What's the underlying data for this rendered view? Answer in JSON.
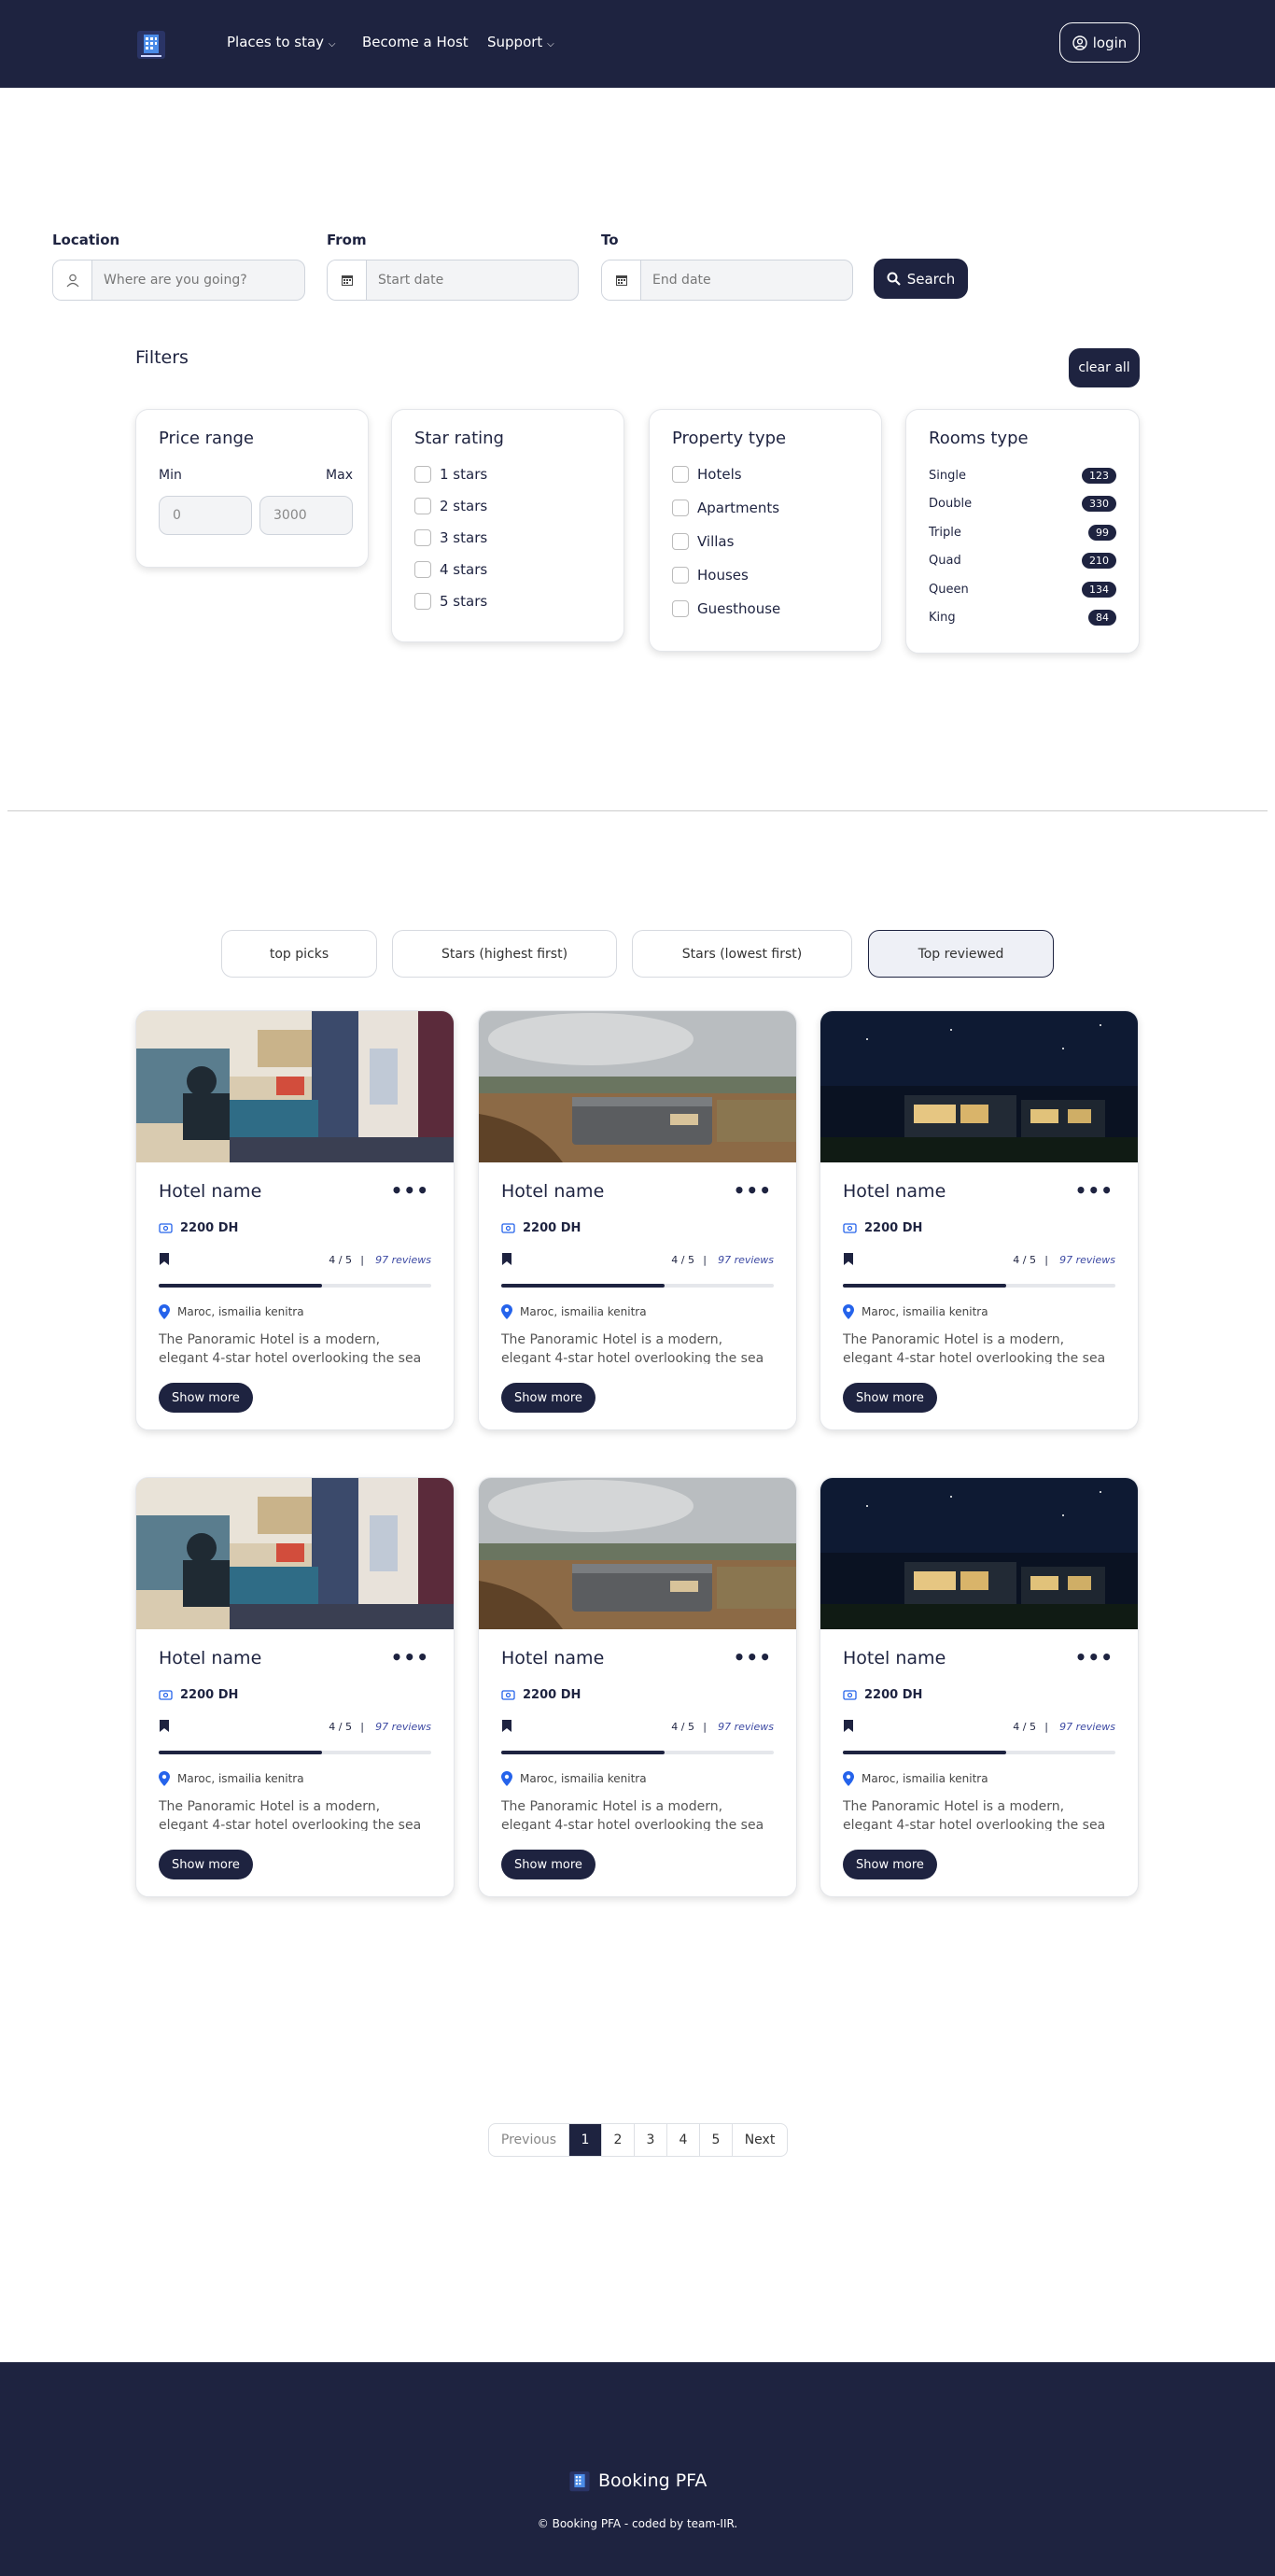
{
  "nav": {
    "items": [
      "Places to stay",
      "Become a Host",
      "Support"
    ],
    "login": "login"
  },
  "search": {
    "location_label": "Location",
    "location_placeholder": "Where are you going?",
    "from_label": "From",
    "from_placeholder": "Start date",
    "to_label": "To",
    "to_placeholder": "End date",
    "button": "Search"
  },
  "filters": {
    "title": "Filters",
    "clear": "clear all",
    "price": {
      "title": "Price range",
      "min_label": "Min",
      "max_label": "Max",
      "min_value": "0",
      "max_value": "3000"
    },
    "stars": {
      "title": "Star rating",
      "options": [
        "1 stars",
        "2 stars",
        "3 stars",
        "4 stars",
        "5 stars"
      ]
    },
    "property": {
      "title": "Property type",
      "options": [
        "Hotels",
        "Apartments",
        "Villas",
        "Houses",
        "Guesthouse"
      ]
    },
    "rooms": {
      "title": "Rooms type",
      "items": [
        {
          "name": "Single",
          "count": "123"
        },
        {
          "name": "Double",
          "count": "330"
        },
        {
          "name": "Triple",
          "count": "99"
        },
        {
          "name": "Quad",
          "count": "210"
        },
        {
          "name": "Queen",
          "count": "134"
        },
        {
          "name": "King",
          "count": "84"
        }
      ]
    }
  },
  "sort": [
    "top picks",
    "Stars (highest first)",
    "Stars (lowest first)",
    "Top reviewed"
  ],
  "sort_active": "Top reviewed",
  "hotels": [
    {
      "name": "Hotel name",
      "price": "2200 DH",
      "score": "4 / 5",
      "reviews": "97 reviews",
      "location": "Maroc, ismailia kenitra",
      "description": "The Panoramic Hotel is a modern, elegant 4-star hotel overlooking the sea",
      "button": "Show more",
      "rating_fraction": 0.6
    },
    {
      "name": "Hotel name",
      "price": "2200 DH",
      "score": "4 / 5",
      "reviews": "97 reviews",
      "location": "Maroc, ismailia kenitra",
      "description": "The Panoramic Hotel is a modern, elegant 4-star hotel overlooking the sea",
      "button": "Show more",
      "rating_fraction": 0.6
    },
    {
      "name": "Hotel name",
      "price": "2200 DH",
      "score": "4 / 5",
      "reviews": "97 reviews",
      "location": "Maroc, ismailia kenitra",
      "description": "The Panoramic Hotel is a modern, elegant 4-star hotel overlooking the sea",
      "button": "Show more",
      "rating_fraction": 0.6
    },
    {
      "name": "Hotel name",
      "price": "2200 DH",
      "score": "4 / 5",
      "reviews": "97 reviews",
      "location": "Maroc, ismailia kenitra",
      "description": "The Panoramic Hotel is a modern, elegant 4-star hotel overlooking the sea",
      "button": "Show more",
      "rating_fraction": 0.6
    },
    {
      "name": "Hotel name",
      "price": "2200 DH",
      "score": "4 / 5",
      "reviews": "97 reviews",
      "location": "Maroc, ismailia kenitra",
      "description": "The Panoramic Hotel is a modern, elegant 4-star hotel overlooking the sea",
      "button": "Show more",
      "rating_fraction": 0.6
    },
    {
      "name": "Hotel name",
      "price": "2200 DH",
      "score": "4 / 5",
      "reviews": "97 reviews",
      "location": "Maroc, ismailia kenitra",
      "description": "The Panoramic Hotel is a modern, elegant 4-star hotel overlooking the sea",
      "button": "Show more",
      "rating_fraction": 0.6
    }
  ],
  "pagination": {
    "previous": "Previous",
    "pages": [
      "1",
      "2",
      "3",
      "4",
      "5"
    ],
    "current": "1",
    "next": "Next"
  },
  "footer": {
    "brand": "Booking PFA",
    "copyright": "© Booking PFA - coded by team-IIR."
  },
  "colors": {
    "primary": "#1e2340",
    "accent_link": "#3d4aa3",
    "pin": "#2563eb"
  }
}
